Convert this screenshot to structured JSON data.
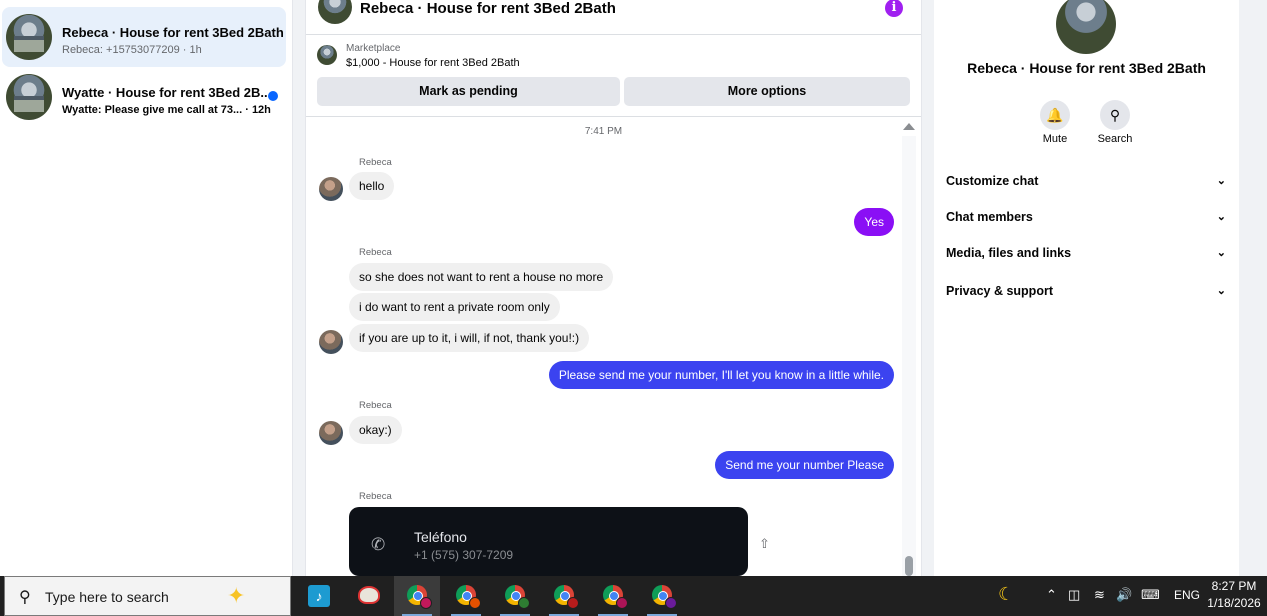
{
  "conversations": [
    {
      "name": "Rebeca · House for rent 3Bed 2Bath",
      "preview": "Rebeca: +15753077209 · 1h",
      "active": true,
      "unread": false
    },
    {
      "name": "Wyatte · House for rent 3Bed 2B...",
      "preview": "Wyatte: Please give me call at 73... · 12h",
      "active": false,
      "unread": true
    }
  ],
  "chat": {
    "title": "Rebeca · House for rent 3Bed 2Bath",
    "info_icon": "i",
    "marketplace_label": "Marketplace",
    "listing": "$1,000 - House for rent 3Bed 2Bath",
    "mark_pending": "Mark as pending",
    "more_options": "More options",
    "timestamp": "7:41 PM",
    "sender": "Rebeca",
    "messages": [
      {
        "dir": "in",
        "text": "hello"
      },
      {
        "dir": "out",
        "text": "Yes"
      },
      {
        "dir": "in",
        "text": "so she does not want to rent a house no more"
      },
      {
        "dir": "in",
        "text": "i do want to rent a private room only"
      },
      {
        "dir": "in",
        "text": "if you are up to it, i will, if not, thank you!:)"
      },
      {
        "dir": "out",
        "text": "Please send me your number, I'll let you know in a little while."
      },
      {
        "dir": "in",
        "text": "okay:)"
      },
      {
        "dir": "out",
        "text": "Send me your number Please"
      }
    ],
    "contact_card": {
      "title": "Teléfono",
      "number": "+1 (575) 307-7209"
    }
  },
  "details": {
    "title": "Rebeca · House for rent 3Bed 2Bath",
    "mute": "Mute",
    "search": "Search",
    "sections": [
      "Customize chat",
      "Chat members",
      "Media, files and links",
      "Privacy & support"
    ]
  },
  "taskbar": {
    "search_placeholder": "Type here to search",
    "language": "ENG",
    "time": "8:27 PM",
    "date": "1/18/2026"
  },
  "colors": {
    "outgoing": "#3b43f0",
    "outgoing_alt": "#8a0ff5",
    "active_conversation": "#e7f0fb",
    "unread_dot": "#0866ff"
  }
}
